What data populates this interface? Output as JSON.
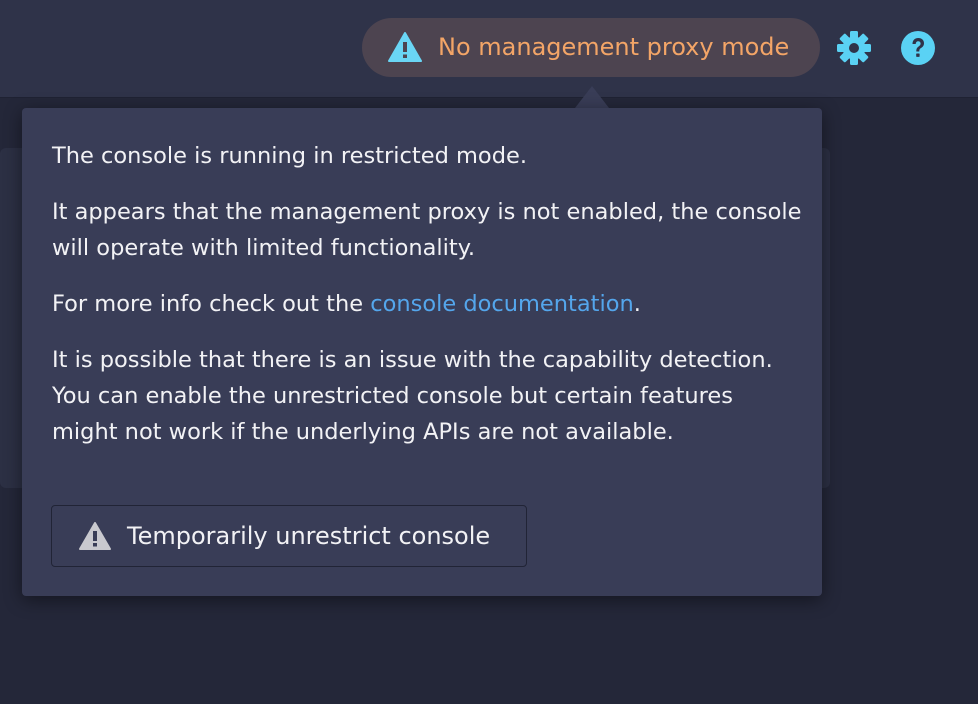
{
  "header": {
    "mode_badge": {
      "label": "No management proxy mode",
      "icon": "warning-triangle-icon",
      "color": "#f3a567"
    },
    "icons": [
      "gear-icon",
      "help-icon"
    ],
    "accent_color": "#5ad2f4"
  },
  "popover": {
    "p1": "The console is running in restricted mode.",
    "p2": "It appears that the management proxy is not enabled, the console will operate with limited functionality.",
    "p3_prefix": "For more info check out the ",
    "p3_link": "console documentation",
    "p3_suffix": ".",
    "p4": "It is possible that there is an issue with the capability detection. You can enable the unrestricted console but certain features might not work if the underlying APIs are not available.",
    "button_label": "Temporarily unrestrict console",
    "button_icon": "warning-triangle-icon",
    "link_color": "#54a6ec"
  }
}
